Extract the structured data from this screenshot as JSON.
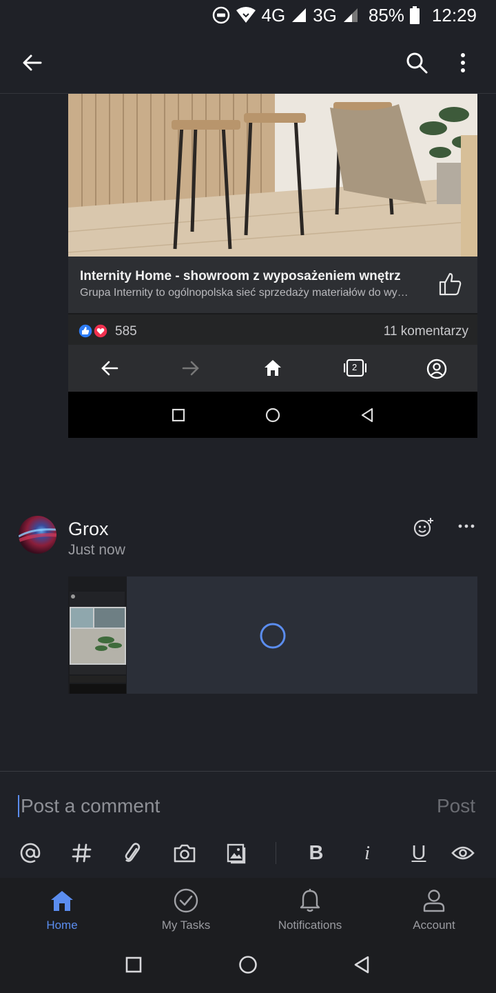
{
  "status_bar": {
    "network_4g": "4G",
    "network_3g": "3G",
    "battery": "85%",
    "time": "12:29"
  },
  "app_bar": {
    "back_icon": "arrow-left-icon",
    "search_icon": "search-icon",
    "more_icon": "more-vertical-icon"
  },
  "shared_screenshot": {
    "link_title": "Internity Home - showroom z wyposażeniem wnętrz",
    "link_description": "Grupa Internity to ogólnopolska sieć sprzedaży materiałów do wy…",
    "reaction_count": "585",
    "comments_count": "11 komentarzy",
    "tab_count": "2"
  },
  "post": {
    "author": "Grox",
    "timestamp": "Just now",
    "attachment_state": "loading"
  },
  "composer": {
    "placeholder": "Post a comment",
    "post_label": "Post",
    "tools": [
      "mention-icon",
      "hashtag-icon",
      "attach-icon",
      "camera-icon",
      "image-icon",
      "bold-icon",
      "italic-icon",
      "underline-icon",
      "preview-icon"
    ],
    "bold": "B",
    "italic": "i",
    "underline": "U"
  },
  "bottom_nav": {
    "items": [
      {
        "label": "Home",
        "icon": "home-icon",
        "active": true
      },
      {
        "label": "My Tasks",
        "icon": "check-circle-icon",
        "active": false
      },
      {
        "label": "Notifications",
        "icon": "bell-icon",
        "active": false
      },
      {
        "label": "Account",
        "icon": "person-icon",
        "active": false
      }
    ]
  },
  "colors": {
    "accent": "#5b8def",
    "background": "#1f2127"
  }
}
